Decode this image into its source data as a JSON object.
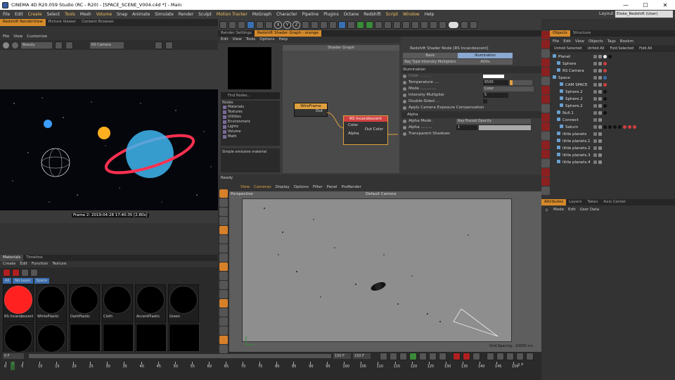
{
  "window": {
    "title": "CINEMA 4D R20.059 Studio (RC - R20) - [SPACE_SCENE_V004.c4d *] - Main",
    "min": "—",
    "max": "☐",
    "close": "✕"
  },
  "menu": [
    "File",
    "Edit",
    "Create",
    "Select",
    "Tools",
    "Mesh",
    "Volume",
    "Snap",
    "Animate",
    "Simulate",
    "Render",
    "Sculpt",
    "Motion Tracker",
    "MoGraph",
    "Character",
    "Pipeline",
    "Plugins",
    "Octane",
    "Redshift",
    "Script",
    "Window",
    "Help"
  ],
  "menu_highlight": [
    "Create",
    "Tools",
    "Volume",
    "Motion Tracker",
    "Script",
    "Window"
  ],
  "layout": {
    "label": "Layout:",
    "value": "Eloke_Redshift (User)"
  },
  "toolbar": {
    "x": "X",
    "y": "Y",
    "z": "Z"
  },
  "renderview": {
    "tab": "Redshift RenderView",
    "tabs_other": [
      "Picture Viewer",
      "Content Browser"
    ],
    "menu": [
      "File",
      "View",
      "Customize"
    ],
    "mode": "Beauty",
    "camera": "RS Camera",
    "frame_info": "Frame  2:  2019-04-28  17:40:35  [2.80s]"
  },
  "materials": {
    "tabs": [
      "Materials",
      "Timeline"
    ],
    "menu": [
      "Create",
      "Edit",
      "Function",
      "Texture"
    ],
    "filters": [
      "All",
      "No Layer",
      "Space"
    ],
    "items": [
      "RS Incandescent",
      "WhitePlastic",
      "DarkPlastic",
      "Cloth",
      "AccentPlastic",
      "Green",
      "",
      "",
      "",
      "",
      "",
      ""
    ]
  },
  "shader": {
    "tabs": [
      "Render Settings",
      "Redshift Shader Graph - orange"
    ],
    "menu": [
      "Edit",
      "View",
      "Tools",
      "Options",
      "Help"
    ],
    "graph_title": "Shader Graph",
    "find": "Find Nodes...",
    "nodes_header": "Nodes",
    "node_list": [
      "Materials",
      "Textures",
      "Utilities",
      "Environment",
      "Lights",
      "Volume",
      "Math"
    ],
    "desc": "Simple emissive material",
    "wireframe": {
      "title": "WireFrame",
      "out": "Out"
    },
    "rsinc": {
      "title": "RS Incandescent",
      "in1": "Color",
      "in2": "Alpha",
      "out": "Out Color"
    }
  },
  "attr_node": {
    "title": "Redshift Shader Node [RS Incandescent]",
    "tab_basic": "Basic",
    "tab_illum": "Illumination",
    "tab_ray": "Ray Type Intensity Multipliers",
    "tab_aovs": "AOVs",
    "section_illum": "Illumination",
    "color": "Color .........",
    "temperature": "Temperature ....",
    "temp_value": "6500",
    "mode": "Mode .............",
    "mode_value": "Color",
    "intensity": "Intensity Multiplier",
    "intensity_value": "5",
    "double": "Double-Sided ...",
    "apply": "Apply Camera Exposure Compensation",
    "section_alpha": "Alpha",
    "alpha_mode": "Alpha Mode .",
    "alpha_mode_value": "Ray-Traced Opacity",
    "alpha": "Alpha .........",
    "alpha_value": "1",
    "shadows": "Transparent Shadows"
  },
  "viewport": {
    "status": "Ready",
    "menu": [
      "View",
      "Cameras",
      "Display",
      "Options",
      "Filter",
      "Panel",
      "ProRender"
    ],
    "label": "Perspective",
    "camera": "Default Camera",
    "grid": "Grid Spacing : 10000 cm"
  },
  "objects": {
    "tabs": [
      "Objects",
      "Structure"
    ],
    "menu": [
      "File",
      "Edit",
      "View",
      "Objects",
      "Tags",
      "Bookm"
    ],
    "fold": [
      "Unfold Selected",
      "Unfold All",
      "Fold Selected",
      "Fold All"
    ],
    "rows": [
      "Planet",
      "Sphere",
      "RS Camera",
      "Space",
      "CAM SPACE",
      "Sphere.2",
      "Sphere.2",
      "Sphere.2",
      "Null.1",
      "Connect",
      "Saturn",
      "little planets",
      "little planets.1",
      "little planets.2",
      "little planets.3",
      "little planets.4"
    ]
  },
  "attributes": {
    "tabs": [
      "Attributes",
      "Layers",
      "Takes",
      "Axis Center"
    ],
    "menu": [
      "Mode",
      "Edit",
      "User Data"
    ]
  },
  "timeline": {
    "start": "0 F",
    "cur": "0 F",
    "end1": "150 F",
    "end2": "150 F",
    "ticks": [
      "0",
      "2",
      "5",
      "10",
      "15",
      "20",
      "25",
      "30",
      "35",
      "40",
      "45",
      "50",
      "55",
      "60",
      "65",
      "70",
      "75",
      "80",
      "85",
      "90",
      "95",
      "100",
      "105",
      "110",
      "115",
      "120",
      "125",
      "130",
      "135",
      "140",
      "145",
      "150"
    ],
    "right": "2 F"
  },
  "colors": {
    "accent": "#e08a2a",
    "red": "#b02020",
    "blue": "#3a6fb0",
    "saturn": "#ff3050",
    "globe": "#3fb6f0"
  }
}
